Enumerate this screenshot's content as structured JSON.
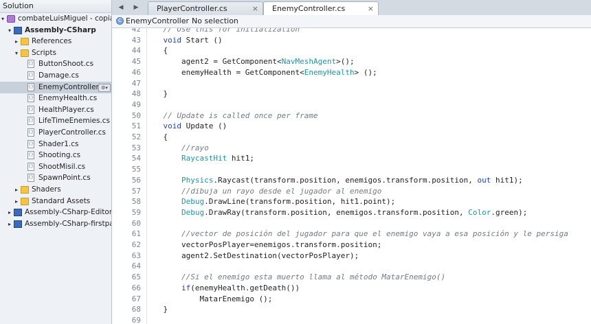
{
  "solution_pane": {
    "title": "Solution",
    "rows": [
      {
        "label": "combateLuisMiguel - copia",
        "indent": 0,
        "icon": "solution",
        "tri": "▾",
        "bold": false
      },
      {
        "label": "Assembly-CSharp",
        "indent": 1,
        "icon": "project",
        "tri": "▾",
        "bold": true
      },
      {
        "label": "References",
        "indent": 2,
        "icon": "folder",
        "tri": "▸",
        "bold": false
      },
      {
        "label": "Scripts",
        "indent": 2,
        "icon": "folder",
        "tri": "▾",
        "bold": false
      },
      {
        "label": "ButtonShoot.cs",
        "indent": 3,
        "icon": "file",
        "tri": "",
        "bold": false
      },
      {
        "label": "Damage.cs",
        "indent": 3,
        "icon": "file",
        "tri": "",
        "bold": false
      },
      {
        "label": "EnemyController.cs",
        "indent": 3,
        "icon": "file",
        "tri": "",
        "bold": false,
        "selected": true
      },
      {
        "label": "EnemyHealth.cs",
        "indent": 3,
        "icon": "file",
        "tri": "",
        "bold": false
      },
      {
        "label": "HealthPlayer.cs",
        "indent": 3,
        "icon": "file",
        "tri": "",
        "bold": false
      },
      {
        "label": "LifeTimeEnemies.cs",
        "indent": 3,
        "icon": "file",
        "tri": "",
        "bold": false
      },
      {
        "label": "PlayerController.cs",
        "indent": 3,
        "icon": "file",
        "tri": "",
        "bold": false
      },
      {
        "label": "Shader1.cs",
        "indent": 3,
        "icon": "file",
        "tri": "",
        "bold": false
      },
      {
        "label": "Shooting.cs",
        "indent": 3,
        "icon": "file",
        "tri": "",
        "bold": false
      },
      {
        "label": "ShootMisil.cs",
        "indent": 3,
        "icon": "file",
        "tri": "",
        "bold": false
      },
      {
        "label": "SpawnPoint.cs",
        "indent": 3,
        "icon": "file",
        "tri": "",
        "bold": false
      },
      {
        "label": "Shaders",
        "indent": 2,
        "icon": "folder",
        "tri": "▸",
        "bold": false
      },
      {
        "label": "Standard Assets",
        "indent": 2,
        "icon": "folder",
        "tri": "▸",
        "bold": false
      },
      {
        "label": "Assembly-CSharp-Editor-firs",
        "indent": 1,
        "icon": "project",
        "tri": "▸",
        "bold": false
      },
      {
        "label": "Assembly-CSharp-firstpass",
        "indent": 1,
        "icon": "project",
        "tri": "▸",
        "bold": false
      }
    ]
  },
  "tabs": [
    {
      "label": "PlayerController.cs",
      "close": "×",
      "active": false
    },
    {
      "label": "EnemyController.cs",
      "close": "×",
      "active": true
    }
  ],
  "nav": {
    "back": "◀",
    "forward": "▶"
  },
  "breadcrumb": {
    "class_name": "EnemyController",
    "separator": "›",
    "member": "No selection",
    "icon_glyph": "C"
  },
  "code_lines": [
    {
      "n": 42,
      "tokens": [
        {
          "t": "    // Use this for initialization",
          "c": "cm"
        }
      ]
    },
    {
      "n": 43,
      "tokens": [
        {
          "t": "    ",
          "c": "pl"
        },
        {
          "t": "void",
          "c": "kw"
        },
        {
          "t": " Start ()",
          "c": "pl"
        }
      ]
    },
    {
      "n": 44,
      "tokens": [
        {
          "t": "    {",
          "c": "pl"
        }
      ]
    },
    {
      "n": 45,
      "tokens": [
        {
          "t": "        agent2 = GetComponent<",
          "c": "pl"
        },
        {
          "t": "NavMeshAgent",
          "c": "type"
        },
        {
          "t": ">();",
          "c": "pl"
        }
      ]
    },
    {
      "n": 46,
      "tokens": [
        {
          "t": "        enemyHealth = GetComponent<",
          "c": "pl"
        },
        {
          "t": "EnemyHealth",
          "c": "type"
        },
        {
          "t": "> ();",
          "c": "pl"
        }
      ]
    },
    {
      "n": 47,
      "tokens": []
    },
    {
      "n": 48,
      "tokens": [
        {
          "t": "    }",
          "c": "pl"
        }
      ]
    },
    {
      "n": 49,
      "tokens": []
    },
    {
      "n": 50,
      "tokens": [
        {
          "t": "    // Update is called once per frame",
          "c": "cm"
        }
      ]
    },
    {
      "n": 51,
      "tokens": [
        {
          "t": "    ",
          "c": "pl"
        },
        {
          "t": "void",
          "c": "kw"
        },
        {
          "t": " Update ()",
          "c": "pl"
        }
      ]
    },
    {
      "n": 52,
      "tokens": [
        {
          "t": "    {",
          "c": "pl"
        }
      ]
    },
    {
      "n": 53,
      "tokens": [
        {
          "t": "        //rayo",
          "c": "cm"
        }
      ]
    },
    {
      "n": 54,
      "tokens": [
        {
          "t": "        ",
          "c": "pl"
        },
        {
          "t": "RaycastHit",
          "c": "type"
        },
        {
          "t": " hit1;",
          "c": "pl"
        }
      ]
    },
    {
      "n": 55,
      "tokens": []
    },
    {
      "n": 56,
      "tokens": [
        {
          "t": "        ",
          "c": "pl"
        },
        {
          "t": "Physics",
          "c": "type"
        },
        {
          "t": ".Raycast(transform.position, enemigos.transform.position, ",
          "c": "pl"
        },
        {
          "t": "out",
          "c": "kw"
        },
        {
          "t": " hit1);",
          "c": "pl"
        }
      ]
    },
    {
      "n": 57,
      "tokens": [
        {
          "t": "        //dibuja un rayo desde el jugador al enemigo",
          "c": "cm"
        }
      ]
    },
    {
      "n": 58,
      "tokens": [
        {
          "t": "        ",
          "c": "pl"
        },
        {
          "t": "Debug",
          "c": "type"
        },
        {
          "t": ".DrawLine(transform.position, hit1.point);",
          "c": "pl"
        }
      ]
    },
    {
      "n": 59,
      "tokens": [
        {
          "t": "        ",
          "c": "pl"
        },
        {
          "t": "Debug",
          "c": "type"
        },
        {
          "t": ".DrawRay(transform.position, enemigos.transform.position, ",
          "c": "pl"
        },
        {
          "t": "Color",
          "c": "type"
        },
        {
          "t": ".green);",
          "c": "pl"
        }
      ]
    },
    {
      "n": 60,
      "tokens": []
    },
    {
      "n": 61,
      "tokens": [
        {
          "t": "        //vector de posición del jugador para que el enemigo vaya a esa posición y le persiga",
          "c": "cm"
        }
      ]
    },
    {
      "n": 62,
      "tokens": [
        {
          "t": "        vectorPosPlayer=enemigos.transform.position;",
          "c": "pl"
        }
      ]
    },
    {
      "n": 63,
      "tokens": [
        {
          "t": "        agent2.SetDestination(vectorPosPlayer);",
          "c": "pl"
        }
      ]
    },
    {
      "n": 64,
      "tokens": []
    },
    {
      "n": 65,
      "tokens": [
        {
          "t": "        //Si el enemigo esta muerto llama al método MatarEnemigo()",
          "c": "cm"
        }
      ]
    },
    {
      "n": 66,
      "tokens": [
        {
          "t": "        ",
          "c": "pl"
        },
        {
          "t": "if",
          "c": "kw"
        },
        {
          "t": "(enemyHealth.getDeath())",
          "c": "pl"
        }
      ]
    },
    {
      "n": 67,
      "tokens": [
        {
          "t": "            MatarEnemigo ();",
          "c": "pl"
        }
      ]
    },
    {
      "n": 68,
      "tokens": [
        {
          "t": "    }",
          "c": "pl"
        }
      ]
    },
    {
      "n": 69,
      "tokens": []
    }
  ],
  "colors": {
    "keyword": "#1f3fbf",
    "type": "#1b96a8",
    "comment": "#727a84",
    "selection": "#c8d0db"
  }
}
